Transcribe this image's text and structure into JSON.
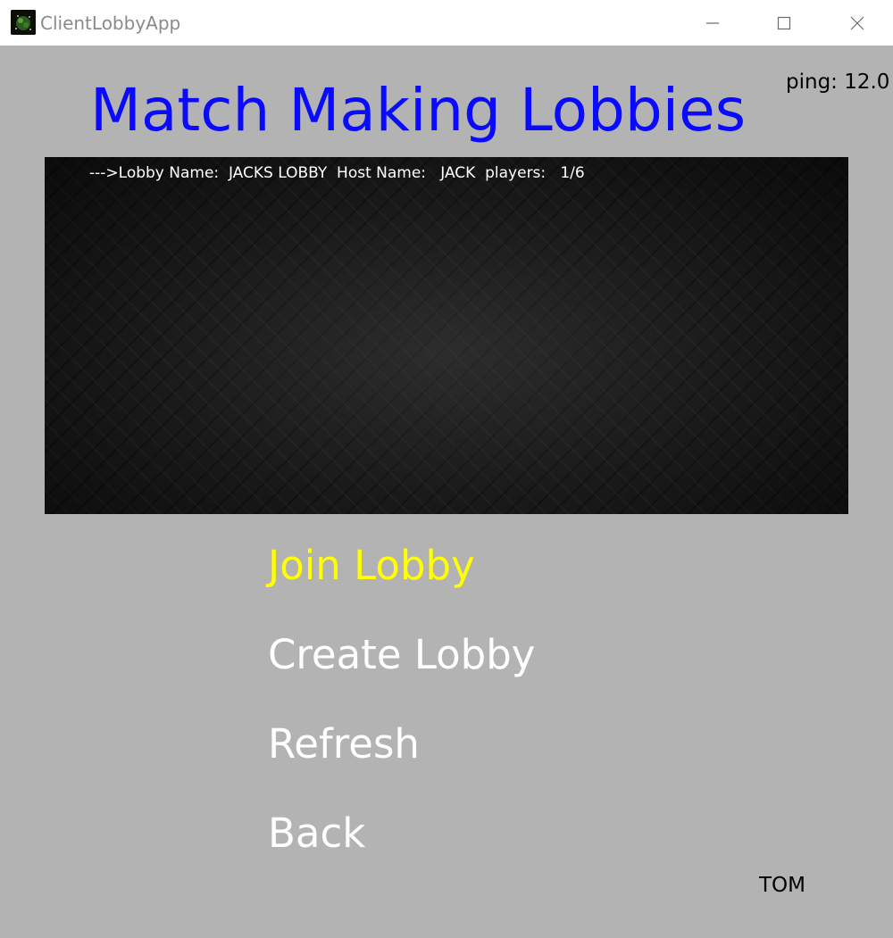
{
  "window": {
    "title": "ClientLobbyApp",
    "icon": "app-logo-icon",
    "controls": [
      "minimize-icon",
      "maximize-icon",
      "close-icon"
    ]
  },
  "header": {
    "title": "Match Making Lobbies",
    "ping": "ping: 12.0"
  },
  "lobby_list": {
    "items": [
      {
        "text": "--->Lobby Name:  JACKS LOBBY  Host Name:   JACK  players:   1/6",
        "lobby_name": "JACKS LOBBY",
        "host_name": "JACK",
        "players": "1/6"
      }
    ]
  },
  "menu": {
    "join_label": "Join Lobby",
    "create_label": "Create Lobby",
    "refresh_label": "Refresh",
    "back_label": "Back"
  },
  "user": {
    "name": "TOM"
  },
  "colors": {
    "background": "#b3b3b3",
    "title": "#0a0aff",
    "selected_menu": "#ffff00",
    "menu": "#ffffff",
    "titlebar": "#ffffff"
  }
}
